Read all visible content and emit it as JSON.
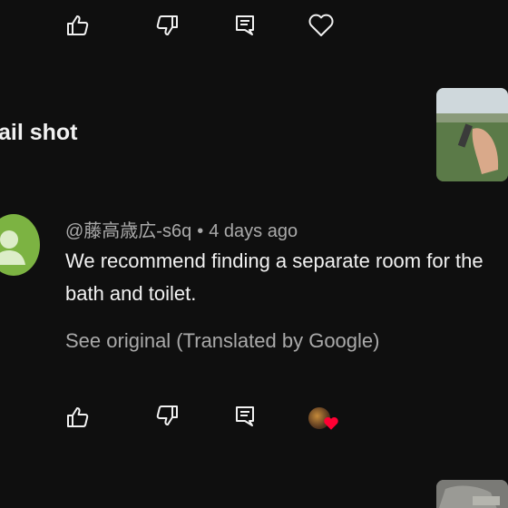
{
  "top_actions": {
    "like_icon": "thumbs-up-icon",
    "dislike_icon": "thumbs-down-icon",
    "reply_icon": "comment-icon",
    "heart_icon": "heart-outline-icon"
  },
  "post": {
    "title_fragment": "ail shot"
  },
  "comment": {
    "author": "@藤高歳広-s6q",
    "separator": "•",
    "timestamp": "4 days ago",
    "text": "We recommend finding a separate room for the bath and toilet.",
    "see_original": "See original (Translated by Google)",
    "avatar_color": "#7cb342",
    "heart_color": "#ff0033"
  }
}
